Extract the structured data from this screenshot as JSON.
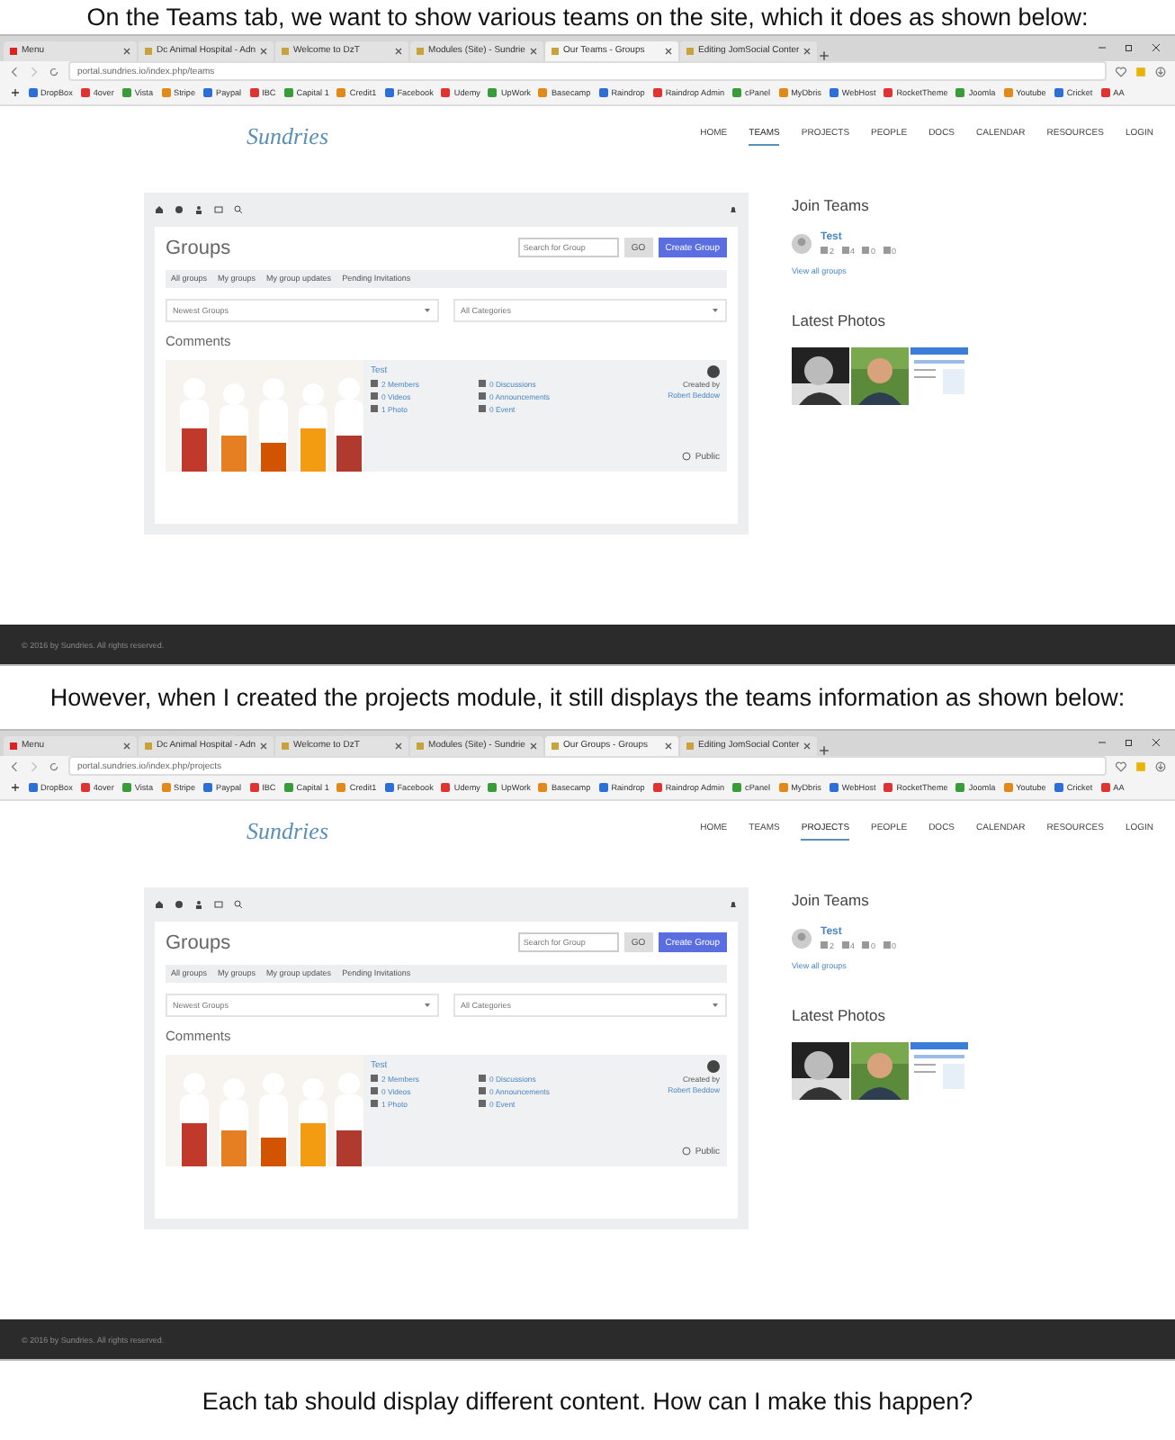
{
  "intro": "On the Teams tab, we want to show various teams on the site, which it does as shown below:",
  "middle": "However, when I created the projects module, it still displays the teams information as shown below:",
  "outro": "Each tab should display different content. How can I make this happen?",
  "screens": [
    {
      "tabs": [
        {
          "label": "Menu",
          "selected": false
        },
        {
          "label": "Dc Animal Hospital - Adn",
          "selected": false
        },
        {
          "label": "Welcome to DzT",
          "selected": false
        },
        {
          "label": "Modules (Site) - Sundrie",
          "selected": false
        },
        {
          "label": "Our Teams - Groups",
          "selected": true
        },
        {
          "label": "Editing JomSocial Conter",
          "selected": false
        }
      ],
      "url": "portal.sundries.io/index.php/teams",
      "bookmarks": [
        "DropBox",
        "4over",
        "Vista",
        "Stripe",
        "Paypal",
        "IBC",
        "Capital 1",
        "Credit1",
        "Facebook",
        "Udemy",
        "UpWork",
        "Basecamp",
        "Raindrop",
        "Raindrop Admin",
        "cPanel",
        "MyDbris",
        "WebHost",
        "RocketTheme",
        "Joomla",
        "Youtube",
        "Cricket",
        "AA"
      ],
      "logo": "Sundries",
      "nav": [
        {
          "label": "HOME",
          "selected": false
        },
        {
          "label": "TEAMS",
          "selected": true
        },
        {
          "label": "PROJECTS",
          "selected": false
        },
        {
          "label": "PEOPLE",
          "selected": false
        },
        {
          "label": "DOCS",
          "selected": false
        },
        {
          "label": "CALENDAR",
          "selected": false
        },
        {
          "label": "RESOURCES",
          "selected": false
        },
        {
          "label": "LOGIN",
          "selected": false
        }
      ],
      "title": "Groups",
      "search_placeholder": "Search for Group",
      "go": "GO",
      "create": "Create Group",
      "filters": [
        "All groups",
        "My groups",
        "My group updates",
        "Pending Invitations"
      ],
      "sort": "Newest Groups",
      "category": "All Categories",
      "section": "Comments",
      "group": {
        "name": "Test",
        "stats": [
          "2 Members",
          "0 Discussions",
          "0 Videos",
          "0 Announcements",
          "1 Photo",
          "0 Event"
        ],
        "created_by": "Created by",
        "owner": "Robert Beddow",
        "privacy": "Public"
      },
      "join_title": "Join Teams",
      "team": {
        "name": "Test",
        "counts": [
          "2",
          "4",
          "0",
          "0"
        ]
      },
      "view_all": "View all groups",
      "photos_title": "Latest Photos",
      "footer": "© 2016 by Sundries. All rights reserved."
    },
    {
      "tabs": [
        {
          "label": "Menu",
          "selected": false
        },
        {
          "label": "Dc Animal Hospital - Adn",
          "selected": false
        },
        {
          "label": "Welcome to DzT",
          "selected": false
        },
        {
          "label": "Modules (Site) - Sundrie",
          "selected": false
        },
        {
          "label": "Our Groups - Groups",
          "selected": true
        },
        {
          "label": "Editing JomSocial Conter",
          "selected": false
        }
      ],
      "url": "portal.sundries.io/index.php/projects",
      "bookmarks": [
        "DropBox",
        "4over",
        "Vista",
        "Stripe",
        "Paypal",
        "IBC",
        "Capital 1",
        "Credit1",
        "Facebook",
        "Udemy",
        "UpWork",
        "Basecamp",
        "Raindrop",
        "Raindrop Admin",
        "cPanel",
        "MyDbris",
        "WebHost",
        "RocketTheme",
        "Joomla",
        "Youtube",
        "Cricket",
        "AA"
      ],
      "logo": "Sundries",
      "nav": [
        {
          "label": "HOME",
          "selected": false
        },
        {
          "label": "TEAMS",
          "selected": false
        },
        {
          "label": "PROJECTS",
          "selected": true
        },
        {
          "label": "PEOPLE",
          "selected": false
        },
        {
          "label": "DOCS",
          "selected": false
        },
        {
          "label": "CALENDAR",
          "selected": false
        },
        {
          "label": "RESOURCES",
          "selected": false
        },
        {
          "label": "LOGIN",
          "selected": false
        }
      ],
      "title": "Groups",
      "search_placeholder": "Search for Group",
      "go": "GO",
      "create": "Create Group",
      "filters": [
        "All groups",
        "My groups",
        "My group updates",
        "Pending Invitations"
      ],
      "sort": "Newest Groups",
      "category": "All Categories",
      "section": "Comments",
      "group": {
        "name": "Test",
        "stats": [
          "2 Members",
          "0 Discussions",
          "0 Videos",
          "0 Announcements",
          "1 Photo",
          "0 Event"
        ],
        "created_by": "Created by",
        "owner": "Robert Beddow",
        "privacy": "Public"
      },
      "join_title": "Join Teams",
      "team": {
        "name": "Test",
        "counts": [
          "2",
          "4",
          "0",
          "0"
        ]
      },
      "view_all": "View all groups",
      "photos_title": "Latest Photos",
      "footer": "© 2016 by Sundries. All rights reserved."
    }
  ]
}
